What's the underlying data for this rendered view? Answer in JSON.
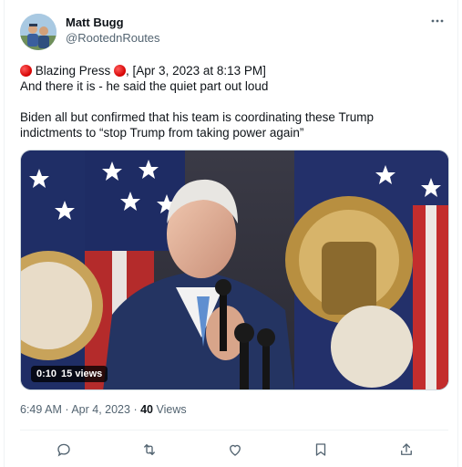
{
  "author": {
    "name": "Matt Bugg",
    "handle": "@RootednRoutes"
  },
  "tweet": {
    "line1_text": " Blazing Press ",
    "line1_suffix": ", [Apr 3, 2023 at 8:13 PM]",
    "line2": "And there it is - he said the quiet part out loud",
    "line3": "Biden all but confirmed that his team is coordinating these Trump",
    "line4": "indictments to “stop Trump from taking power again”"
  },
  "video": {
    "duration": "0:10",
    "views": "15 views"
  },
  "meta": {
    "time": "6:49 AM",
    "date": "Apr 4, 2023",
    "separator": "·",
    "view_count": "40",
    "views_label": "Views"
  },
  "icons": {
    "more": "more-icon",
    "reply": "reply-icon",
    "retweet": "retweet-icon",
    "like": "like-icon",
    "bookmark": "bookmark-icon",
    "share": "share-icon",
    "red_dot": "red-circle-emoji"
  },
  "colors": {
    "text": "#0f1419",
    "secondary": "#536471",
    "border": "#eff3f4",
    "red_dot": "#d40000"
  }
}
